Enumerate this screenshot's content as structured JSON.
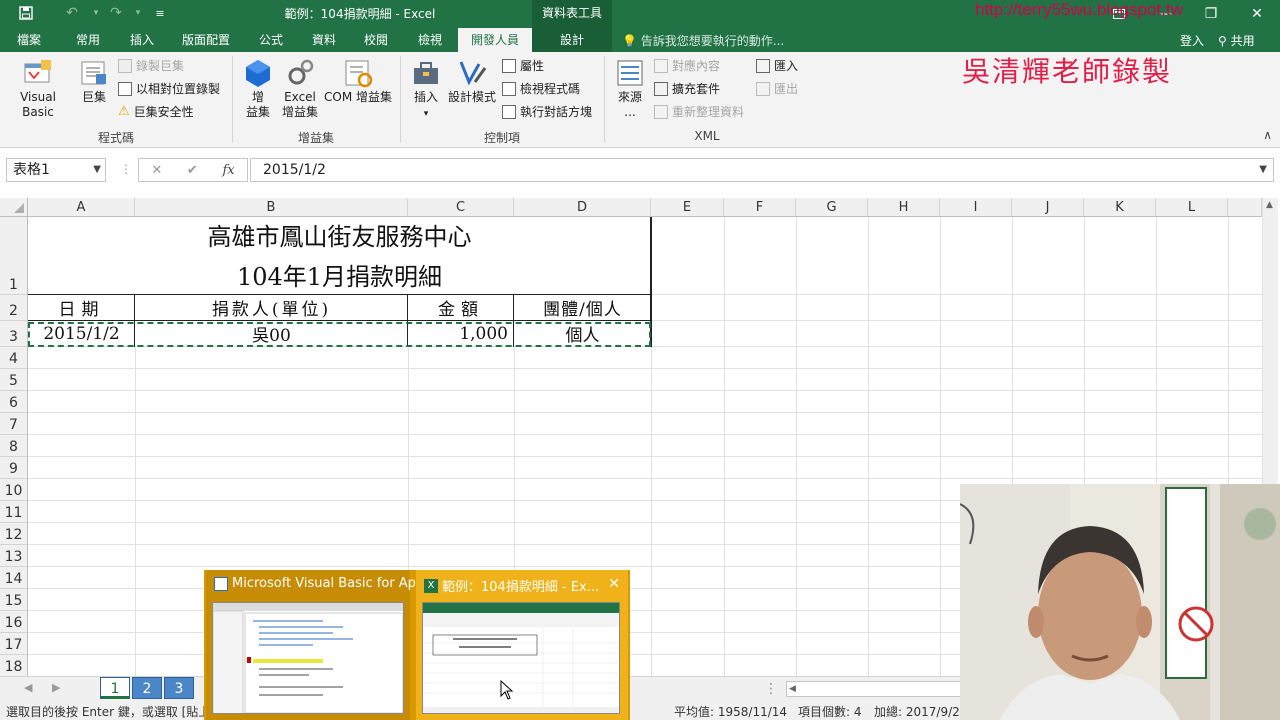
{
  "window": {
    "title": "範例：104捐款明細 - Excel",
    "context_tools_label": "資料表工具",
    "share_label": "共用",
    "signin_label": "登入"
  },
  "tabs": [
    {
      "label": "檔案"
    },
    {
      "label": "常用"
    },
    {
      "label": "插入"
    },
    {
      "label": "版面配置"
    },
    {
      "label": "公式"
    },
    {
      "label": "資料"
    },
    {
      "label": "校閱"
    },
    {
      "label": "檢視"
    },
    {
      "label": "開發人員"
    },
    {
      "label": "設計"
    }
  ],
  "tell_me": "告訴我您想要執行的動作...",
  "watermark": {
    "url": "http://terry55wu.blogspot.tw",
    "text": "吳清輝老師錄製"
  },
  "ribbon": {
    "code": {
      "visual_basic": "Visual Basic",
      "macros": "巨集",
      "record_macro": "錄製巨集",
      "relative_ref": "以相對位置錄製",
      "macro_security": "巨集安全性",
      "title": "程式碼"
    },
    "addins": {
      "addin": "增益集",
      "excel_addin": "Excel 增益集",
      "com_addin": "COM 增益集",
      "title": "增益集",
      "addin_label_1": "增",
      "addin_label_2": "益集",
      "excel_label_1": "Excel",
      "excel_label_2": "增益集"
    },
    "controls": {
      "insert": "插入",
      "design_mode": "設計模式",
      "properties": "屬性",
      "view_code": "檢視程式碼",
      "run_dialog": "執行對話方塊",
      "title": "控制項"
    },
    "xml": {
      "source": "來源",
      "source_more": "...",
      "map_props": "對應內容",
      "expansion_packs": "擴充套件",
      "refresh_data": "重新整理資料",
      "import": "匯入",
      "export": "匯出",
      "title": "XML"
    }
  },
  "formula_bar": {
    "name_box": "表格1",
    "formula": "2015/1/2",
    "fx": "fx",
    "cancel": "✕",
    "enter": "✔"
  },
  "grid": {
    "columns": [
      "A",
      "B",
      "C",
      "D",
      "E",
      "F",
      "G",
      "H",
      "I",
      "J",
      "K",
      "L"
    ],
    "rows": [
      "1",
      "2",
      "3",
      "4",
      "5",
      "6",
      "7",
      "8",
      "9",
      "10",
      "11",
      "12",
      "13",
      "14",
      "15",
      "16",
      "17",
      "18"
    ],
    "title_line1": "高雄市鳳山街友服務中心",
    "title_line2": "104年1月捐款明細",
    "headers": [
      "日期",
      "捐款人(單位)",
      "金額",
      "團體/個人"
    ],
    "row3": [
      "2015/1/2",
      "吳00",
      "1,000",
      "個人"
    ]
  },
  "sheets": [
    "1",
    "2",
    "3"
  ],
  "status": {
    "message": "選取目的後按 Enter 鍵，或選取 [貼上",
    "average": "平均值: 1958/11/14",
    "count": "項目個數: 4",
    "sum": "加總: 2017/9/28"
  },
  "taskbar_thumbs": [
    {
      "title": "Microsoft Visual Basic for Ap..."
    },
    {
      "title": "範例：104捐款明細 - Ex..."
    }
  ],
  "colors": {
    "excel_green": "#217346",
    "thumb_orange": "#f0b21a",
    "watermark_red": "#e0204a"
  }
}
